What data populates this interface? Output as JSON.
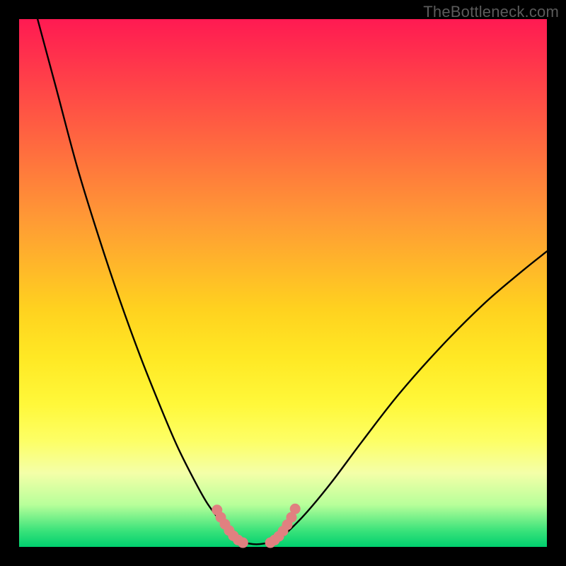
{
  "watermark": "TheBottleneck.com",
  "chart_data": {
    "type": "line",
    "title": "",
    "xlabel": "",
    "ylabel": "",
    "xlim": [
      0,
      1
    ],
    "ylim": [
      0,
      1
    ],
    "series": [
      {
        "name": "curve-left",
        "x": [
          0.035,
          0.07,
          0.11,
          0.15,
          0.19,
          0.23,
          0.27,
          0.3,
          0.33,
          0.355,
          0.38,
          0.4
        ],
        "y": [
          1.0,
          0.87,
          0.72,
          0.59,
          0.47,
          0.36,
          0.26,
          0.19,
          0.13,
          0.085,
          0.05,
          0.02
        ]
      },
      {
        "name": "plateau",
        "x": [
          0.4,
          0.42,
          0.45,
          0.48,
          0.5
        ],
        "y": [
          0.02,
          0.01,
          0.005,
          0.01,
          0.02
        ]
      },
      {
        "name": "curve-right",
        "x": [
          0.5,
          0.54,
          0.59,
          0.65,
          0.72,
          0.8,
          0.88,
          0.95,
          1.0
        ],
        "y": [
          0.02,
          0.06,
          0.12,
          0.2,
          0.29,
          0.38,
          0.46,
          0.52,
          0.56
        ]
      },
      {
        "name": "dotted-left",
        "x": [
          0.375,
          0.382,
          0.39,
          0.398,
          0.406,
          0.415,
          0.424
        ],
        "y": [
          0.07,
          0.056,
          0.043,
          0.031,
          0.021,
          0.013,
          0.008
        ]
      },
      {
        "name": "dotted-right",
        "x": [
          0.476,
          0.484,
          0.492,
          0.5,
          0.508,
          0.516,
          0.523
        ],
        "y": [
          0.008,
          0.013,
          0.02,
          0.03,
          0.042,
          0.056,
          0.072
        ]
      }
    ],
    "colors": {
      "curve": "#000000",
      "dots": "#e08080"
    }
  }
}
